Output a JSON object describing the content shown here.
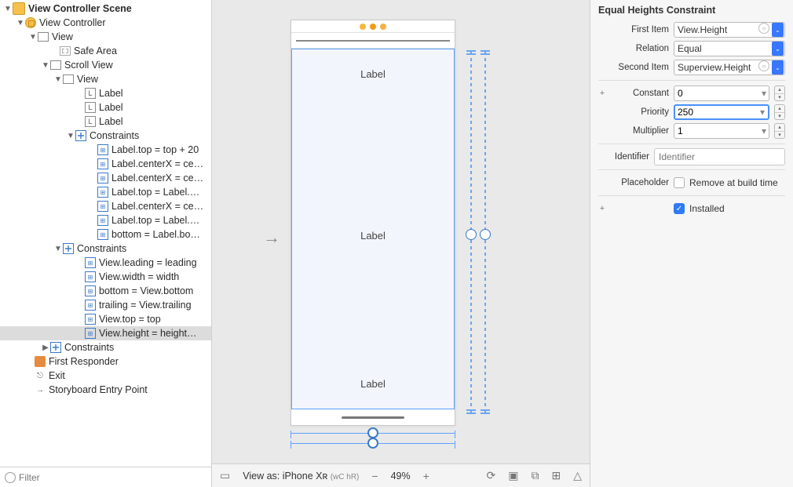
{
  "outline": {
    "scene": "View Controller Scene",
    "vc": "View Controller",
    "rootView": "View",
    "safeArea": "Safe Area",
    "scrollView": "Scroll View",
    "innerView": "View",
    "labels": [
      "Label",
      "Label",
      "Label"
    ],
    "innerConstraintsLabel": "Constraints",
    "innerConstraints": [
      "Label.top = top + 20",
      "Label.centerX = ce…",
      "Label.centerX = ce…",
      "Label.top = Label.…",
      "Label.centerX = ce…",
      "Label.top = Label.…",
      "bottom = Label.bo…"
    ],
    "scrollConstraintsLabel": "Constraints",
    "scrollConstraints": [
      "View.leading = leading",
      "View.width = width",
      "bottom = View.bottom",
      "trailing = View.trailing",
      "View.top = top",
      "View.height = height…"
    ],
    "selectedConstraintIndex": 5,
    "rootConstraints": "Constraints",
    "firstResponder": "First Responder",
    "exit": "Exit",
    "entryPoint": "Storyboard Entry Point"
  },
  "filterPlaceholder": "Filter",
  "canvas": {
    "labels": [
      "Label",
      "Label",
      "Label"
    ]
  },
  "footer": {
    "viewAs": "View as: iPhone Xʀ",
    "sizeClass": "(wC hR)",
    "zoom": "49%"
  },
  "inspector": {
    "title": "Equal Heights Constraint",
    "firstItemLabel": "First Item",
    "firstItem": "View.Height",
    "relationLabel": "Relation",
    "relation": "Equal",
    "secondItemLabel": "Second Item",
    "secondItem": "Superview.Height",
    "constantLabel": "Constant",
    "constant": "0",
    "priorityLabel": "Priority",
    "priority": "250",
    "multiplierLabel": "Multiplier",
    "multiplier": "1",
    "identifierLabel": "Identifier",
    "identifierPlaceholder": "Identifier",
    "placeholderLabel": "Placeholder",
    "placeholderCheck": "Remove at build time",
    "installed": "Installed"
  }
}
